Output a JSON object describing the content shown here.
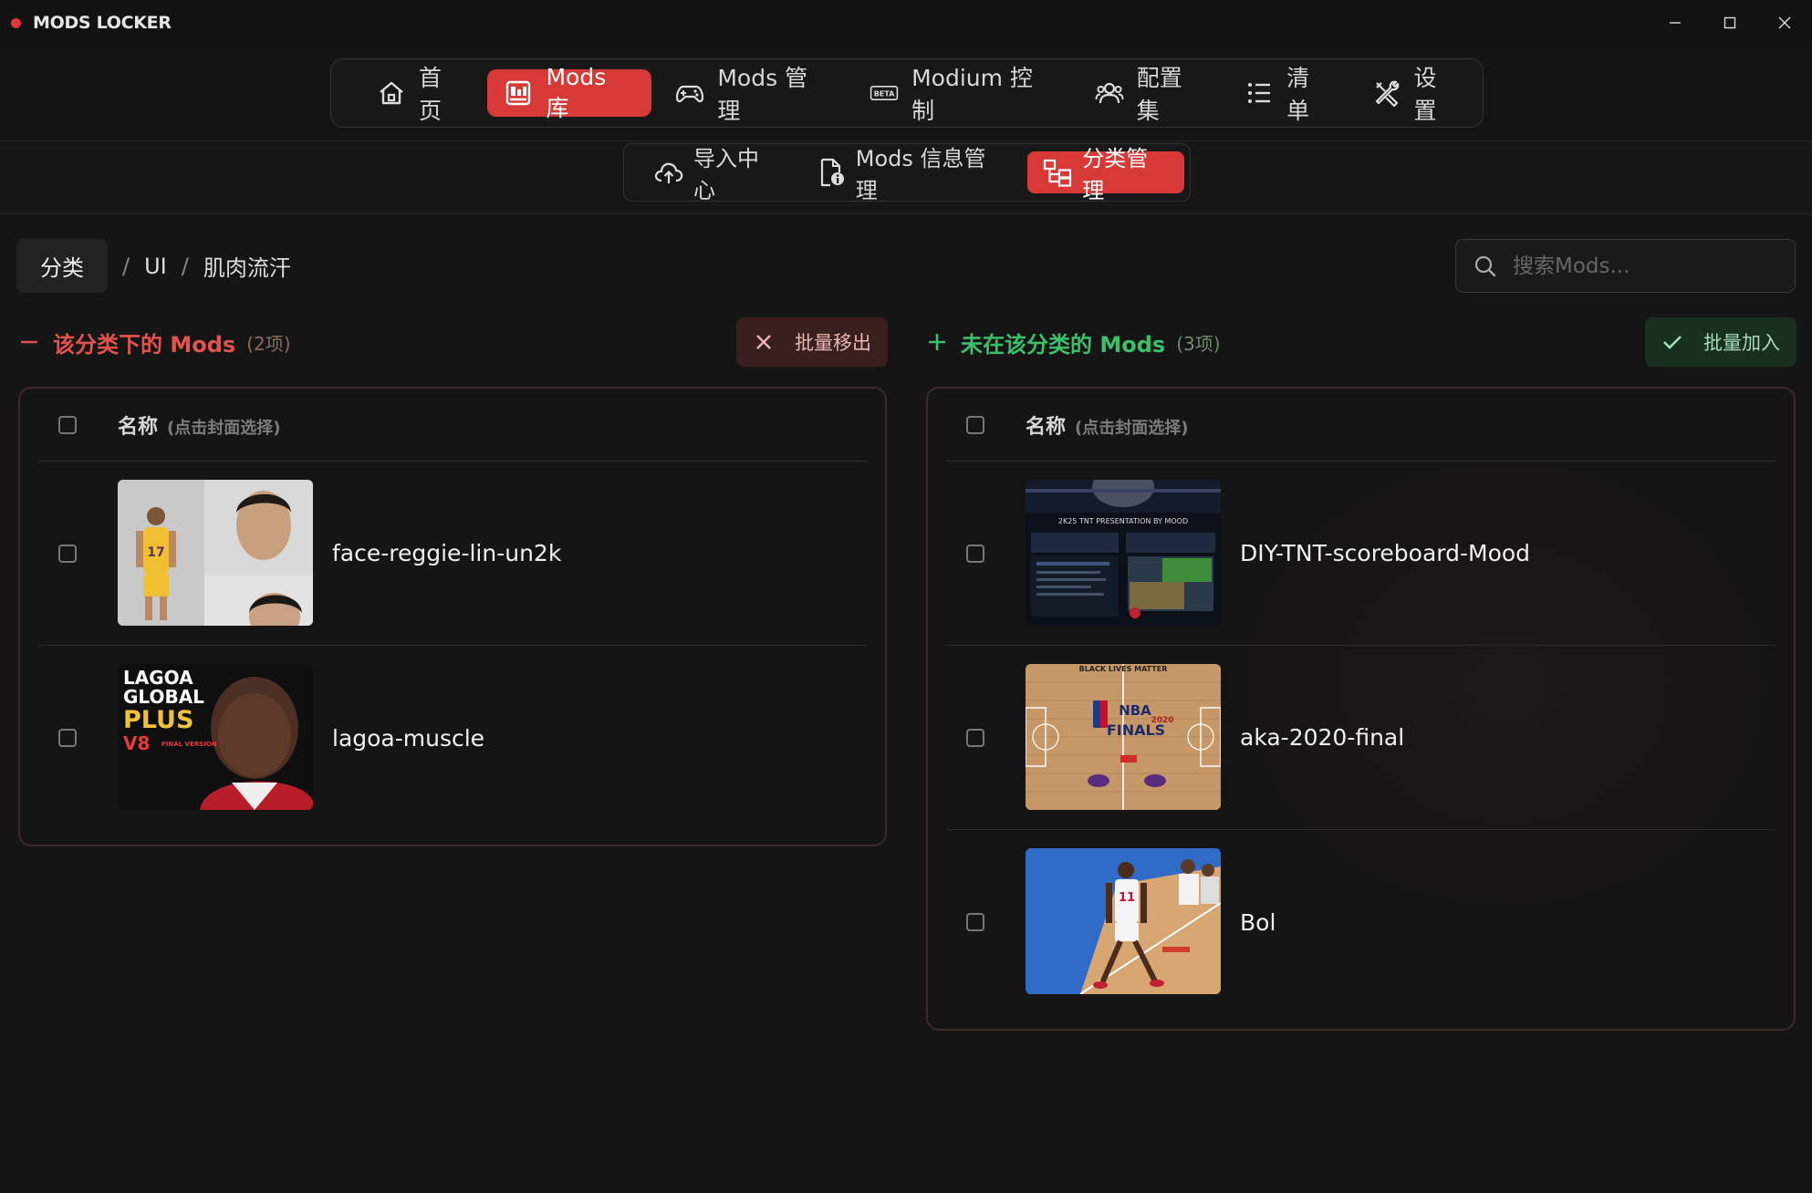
{
  "window": {
    "title": "MODS LOCKER",
    "controls": [
      "minimize",
      "maximize",
      "close"
    ]
  },
  "main_nav": [
    {
      "label": "首页",
      "icon": "home-icon",
      "active": false
    },
    {
      "label": "Mods 库",
      "icon": "library-icon",
      "active": true
    },
    {
      "label": "Mods 管理",
      "icon": "gamepad-icon",
      "active": false
    },
    {
      "label": "Modium 控制",
      "icon": "beta-icon",
      "active": false
    },
    {
      "label": "配置集",
      "icon": "users-icon",
      "active": false
    },
    {
      "label": "清单",
      "icon": "list-icon",
      "active": false
    },
    {
      "label": "设置",
      "icon": "tools-icon",
      "active": false
    }
  ],
  "sub_nav": [
    {
      "label": "导入中心",
      "icon": "cloud-upload-icon",
      "active": false
    },
    {
      "label": "Mods 信息管理",
      "icon": "file-info-icon",
      "active": false
    },
    {
      "label": "分类管理",
      "icon": "category-tree-icon",
      "active": true
    }
  ],
  "breadcrumb": {
    "root": "分类",
    "separator": "/",
    "items": [
      "UI",
      "肌肉流汗"
    ]
  },
  "search": {
    "placeholder": "搜索Mods...",
    "value": ""
  },
  "in_category": {
    "title": "该分类下的 Mods",
    "count": "(2项)",
    "action": "批量移出",
    "header": {
      "name": "名称",
      "hint": "(点击封面选择)"
    },
    "items": [
      {
        "name": "face-reggie-lin-un2k",
        "checked": false
      },
      {
        "name": "lagoa-muscle",
        "checked": false
      }
    ]
  },
  "not_in_category": {
    "title": "未在该分类的 Mods",
    "count": "(3项)",
    "action": "批量加入",
    "header": {
      "name": "名称",
      "hint": "(点击封面选择)"
    },
    "items": [
      {
        "name": "DIY-TNT-scoreboard-Mood",
        "checked": false
      },
      {
        "name": "aka-2020-final",
        "checked": false
      },
      {
        "name": "Bol",
        "checked": false
      }
    ]
  },
  "cover_text": {
    "lagoa": [
      "LAGOA",
      "GLOBAL",
      "PLUS",
      "V8",
      "FINAL VERSION"
    ],
    "tnt": [
      "2K25 TNT PRESENTATION BY MOOD"
    ],
    "finals": [
      "BLACK LIVES MATTER",
      "NBA",
      "FINALS",
      "2020"
    ],
    "bol_jersey": "11"
  },
  "colors": {
    "accent": "#d73a36",
    "remove": "#e2534f",
    "add": "#39c06a",
    "background": "#151515"
  }
}
